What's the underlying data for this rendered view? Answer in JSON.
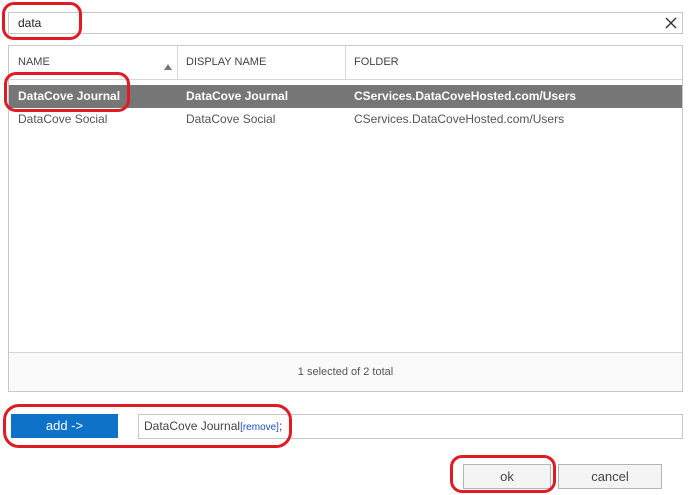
{
  "search": {
    "value": "data",
    "placeholder": ""
  },
  "table": {
    "columns": [
      "NAME",
      "DISPLAY NAME",
      "FOLDER"
    ],
    "rows": [
      {
        "name": "DataCove Journal",
        "display_name": "DataCove Journal",
        "folder": "CServices.DataCoveHosted.com/Users",
        "selected": true
      },
      {
        "name": "DataCove Social",
        "display_name": "DataCove Social",
        "folder": "CServices.DataCoveHosted.com/Users",
        "selected": false
      }
    ],
    "footer": "1 selected of 2 total"
  },
  "add_button": {
    "label": "add ->"
  },
  "selected_field": {
    "item": "DataCove Journal",
    "remove_label": "[remove]",
    "separator": ";"
  },
  "buttons": {
    "ok": "ok",
    "cancel": "cancel"
  },
  "icons": {
    "clear": "close-icon",
    "sort": "sort-ascending-icon"
  },
  "colors": {
    "selected_row_bg": "#767676",
    "primary_button": "#0f72c9",
    "annotation": "#e01b24"
  }
}
